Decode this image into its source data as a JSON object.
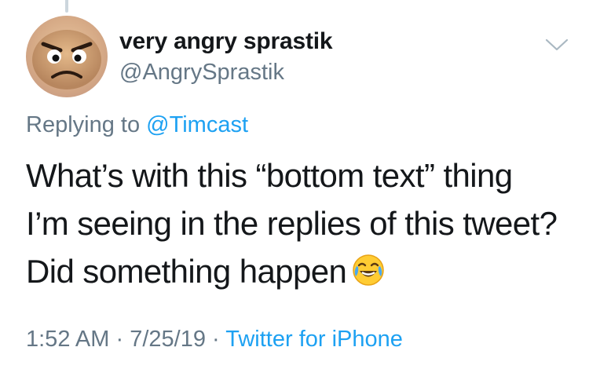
{
  "tweet": {
    "display_name": "very angry sprastik",
    "handle": "@AngrySprastik",
    "replying_prefix": "Replying to",
    "replying_to": "@Timcast",
    "text_lines": [
      "What’s with this “bottom text” thing",
      "I’m seeing in the replies of this tweet?",
      "Did something happen"
    ],
    "emoji": "face-with-tears-of-joy",
    "time": "1:52 AM",
    "separator": "·",
    "date": "7/25/19",
    "source": "Twitter for iPhone"
  },
  "icons": {
    "more_options": "chevron-down-icon",
    "avatar": "angry-bread-avatar"
  },
  "colors": {
    "text": "#14171a",
    "secondary": "#657786",
    "link": "#1da1f2",
    "thread_line": "#ccd6dd"
  }
}
